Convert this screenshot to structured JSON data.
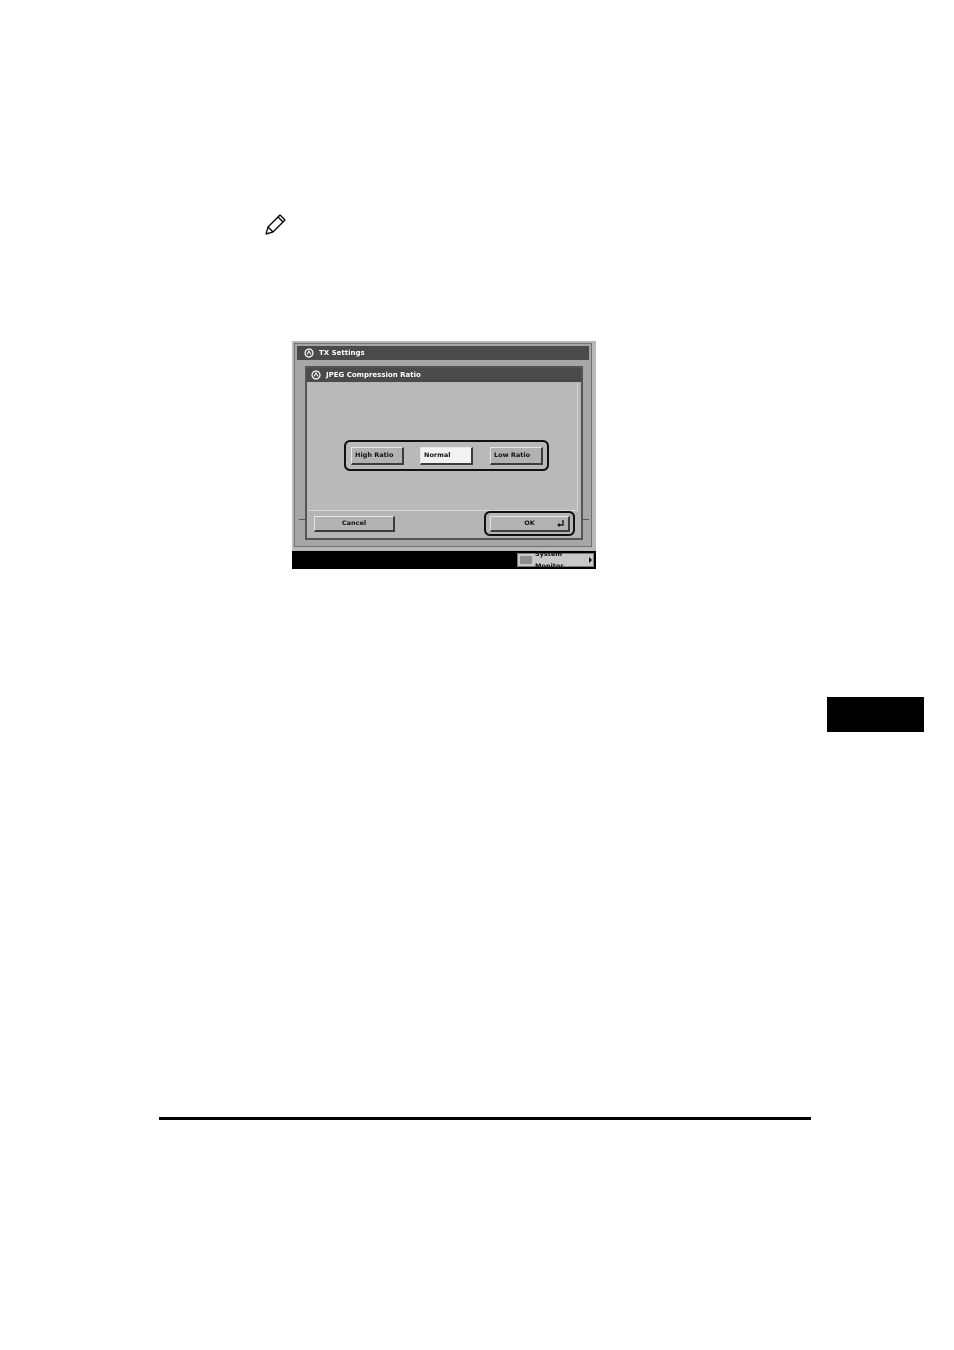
{
  "note": {
    "icon": "pencil-note-icon"
  },
  "screen": {
    "outer_title": "TX Settings",
    "dialog_title": "JPEG Compression Ratio",
    "ratio_options": {
      "high": "High Ratio",
      "normal": "Normal",
      "low": "Low Ratio",
      "selected": "Normal"
    },
    "cancel_label": "Cancel",
    "ok_label": "OK",
    "system_monitor_label": "System Monitor"
  },
  "colors": {
    "titlebar": "#4a4a4a",
    "selected_button": "#f2f2f2",
    "chapter_tab": "#000000"
  }
}
